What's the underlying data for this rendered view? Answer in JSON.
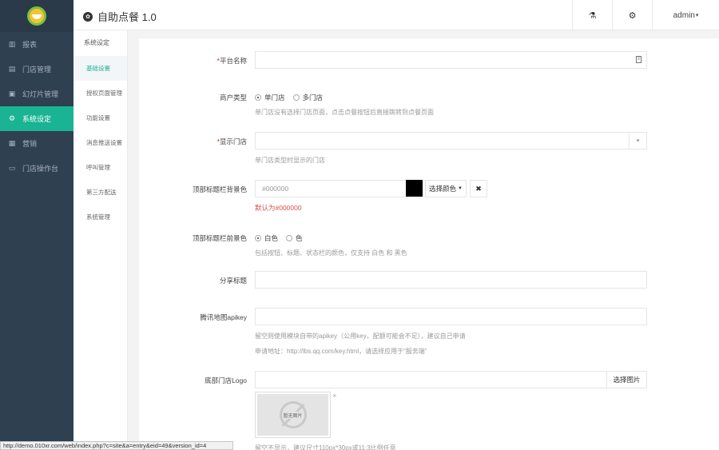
{
  "app": {
    "title": "自助点餐 1.0",
    "badge": "✿",
    "user": "admin"
  },
  "sidebar": {
    "items": [
      {
        "label": "报表",
        "icon": "chart-icon",
        "glyph": "▥"
      },
      {
        "label": "门店管理",
        "icon": "store-icon",
        "glyph": "▤"
      },
      {
        "label": "幻灯片管理",
        "icon": "slides-icon",
        "glyph": "▣"
      },
      {
        "label": "系统设定",
        "icon": "gear-icon",
        "glyph": "⚙"
      },
      {
        "label": "营销",
        "icon": "gift-icon",
        "glyph": "▦"
      },
      {
        "label": "门店操作台",
        "icon": "console-icon",
        "glyph": "▭"
      }
    ],
    "active_index": 3
  },
  "topbar": {
    "btn1_glyph": "⚗",
    "btn2_glyph": "⚙",
    "caret": "▾"
  },
  "subnav": {
    "title": "系统设定",
    "items": [
      "基础设置",
      "授权页面管理",
      "功能设置",
      "消息推送设置",
      "呼叫管理",
      "第三方配送",
      "系统管理"
    ],
    "active_index": 0
  },
  "form": {
    "platform_name": {
      "label": "平台名称",
      "value": "",
      "icon_glyph": "≡"
    },
    "merchant_type": {
      "label": "商户类型",
      "options": [
        "单门店",
        "多门店"
      ],
      "selected": 0,
      "help": "单门店没有选择门店页面，点击点餐按钮后直接跳转到点餐页面"
    },
    "display_store": {
      "label": "显示门店",
      "value": "",
      "caret": "▾",
      "help": "单门店类型时显示的门店"
    },
    "header_bg_color": {
      "label": "顶部标题栏背景色",
      "placeholder": "#000000",
      "swatch": "#000000",
      "pick_label": "选择颜色",
      "clear_glyph": "✖",
      "default_note": "默认为#000000"
    },
    "header_fg_color": {
      "label": "顶部标题栏前景色",
      "options": [
        "白色",
        "黑色"
      ],
      "option2_visible": "色",
      "selected": 0,
      "help": "包括按钮、标题、状态栏的颜色，仅支持 白色 和 黑色"
    },
    "share_title": {
      "label": "分享标题",
      "value": ""
    },
    "tencent_map_key": {
      "label": "腾讯地图apikey",
      "value": "",
      "help1": "留空则使用模块自带的apikey（公用key，配额可能会不足），建议自己申请",
      "help2": "申请地址：http://lbs.qq.com/key.html，请选择应用于“服务端”"
    },
    "footer_logo": {
      "label": "底部门店Logo",
      "value": "",
      "pick_label": "选择图片",
      "no_image_text": "暂无图片",
      "close_glyph": "×",
      "help": "留空不显示，建议尺寸110px*30px或11:3比例任意"
    }
  },
  "status_url": "http://demo.010xr.com/web/index.php?c=site&a=entry&eid=49&version_id=4"
}
